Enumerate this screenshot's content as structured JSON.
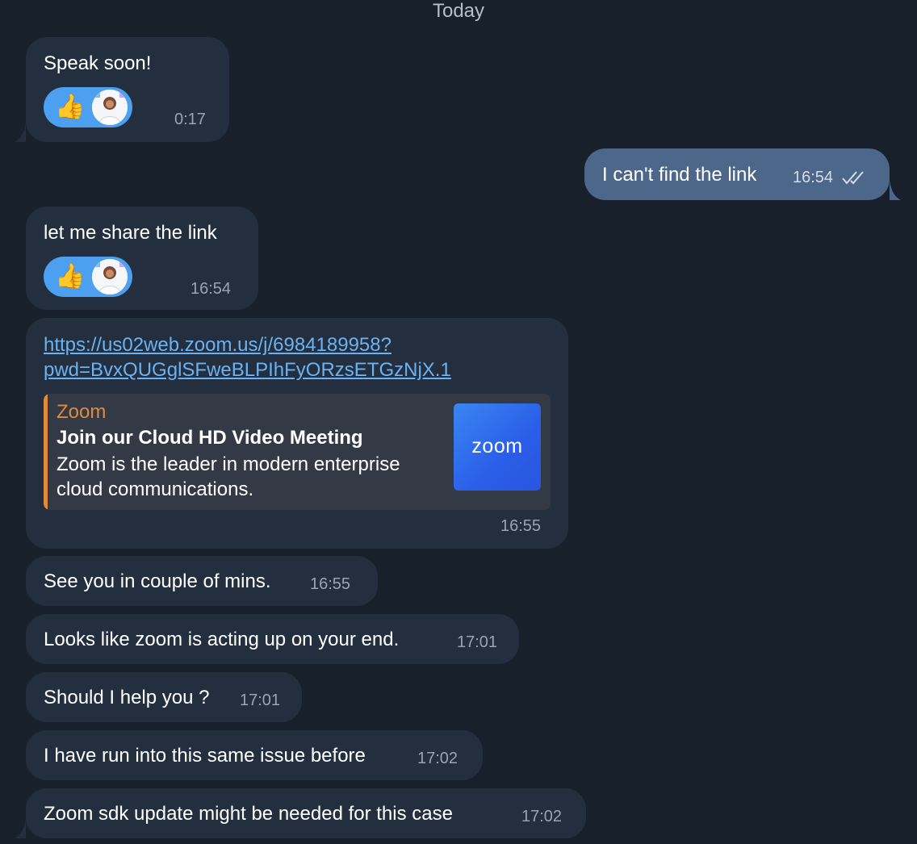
{
  "date_header": "Today",
  "messages": [
    {
      "text": "Speak soon!",
      "time": "0:17"
    },
    {
      "text": "I can't find the link",
      "time": "16:54",
      "status": "double-check-icon"
    },
    {
      "text": "let me share the link",
      "time": "16:54"
    },
    {
      "link_line1": "https://us02web.zoom.us/j/6984189958?",
      "link_line2": "pwd=BvxQUGglSFweBLPIhFyORzsETGzNjX.1",
      "preview": {
        "site": "Zoom",
        "title": "Join our Cloud HD Video Meeting",
        "description": "Zoom is the leader in modern enterprise cloud communications.",
        "thumbnail_text": "zoom"
      },
      "time": "16:55"
    },
    {
      "text": "See you in couple of mins.",
      "time": "16:55"
    },
    {
      "text": "Looks like zoom is acting up on your end.",
      "time": "17:01"
    },
    {
      "text": "Should I help you ?",
      "time": "17:01"
    },
    {
      "text": "I have run into this same issue before",
      "time": "17:02"
    },
    {
      "text": "Zoom sdk update might be needed for this case",
      "time": "17:02"
    }
  ],
  "reactions": {
    "emoji": "👍",
    "icons": [
      "thumbs-up-icon",
      "avatar"
    ]
  },
  "colors": {
    "background": "#18212b",
    "incoming_bubble": "#232f3e",
    "outgoing_bubble": "#4c6789",
    "link": "#6ab2f2",
    "preview_accent": "#e08a3c",
    "reaction": "#4d9ff0"
  }
}
